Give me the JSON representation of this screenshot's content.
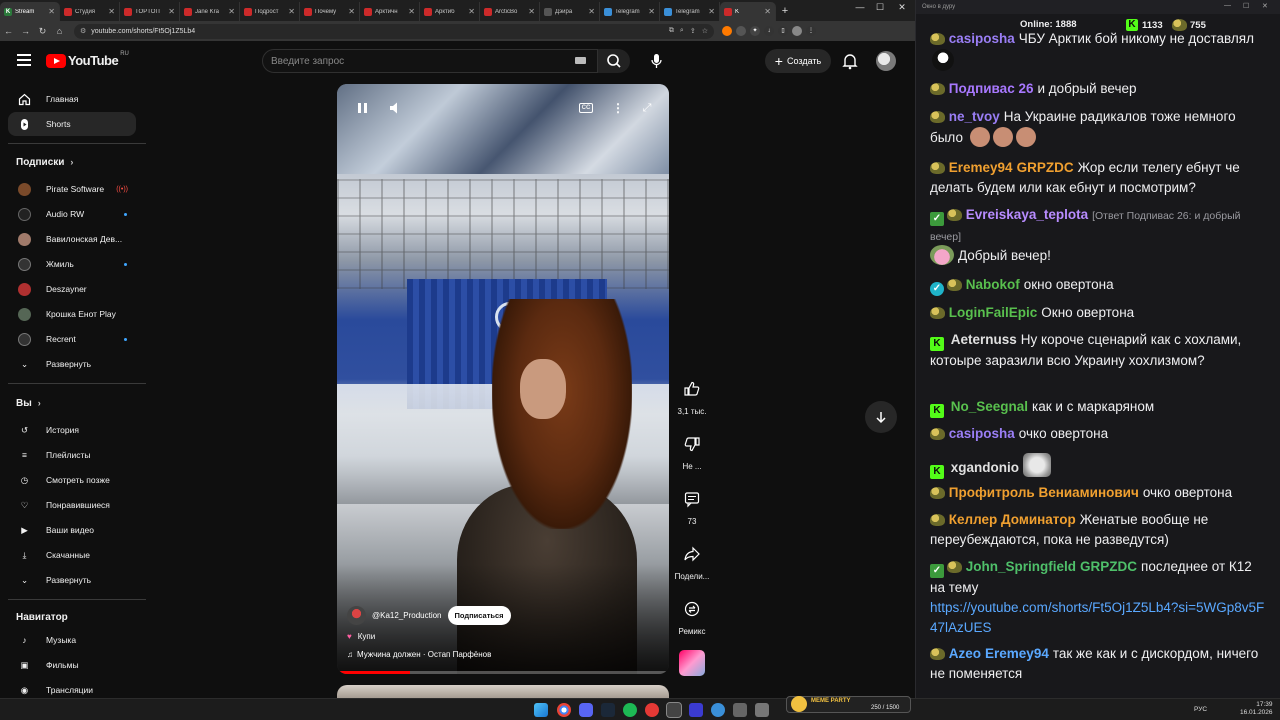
{
  "browser": {
    "tabs": [
      {
        "title": "Stream",
        "color": "#2b7a3b",
        "glyph": "K"
      },
      {
        "title": "Студия",
        "color": "#cc2a2a",
        "glyph": ""
      },
      {
        "title": "TOPTOП",
        "color": "#cc2a2a",
        "glyph": ""
      },
      {
        "title": "Jane Kra",
        "color": "#cc2a2a",
        "glyph": ""
      },
      {
        "title": "Подрост",
        "color": "#cc2a2a",
        "glyph": ""
      },
      {
        "title": "Почему",
        "color": "#cc2a2a",
        "glyph": ""
      },
      {
        "title": "Арктичн",
        "color": "#cc2a2a",
        "glyph": ""
      },
      {
        "title": "Арктиб",
        "color": "#cc2a2a",
        "glyph": ""
      },
      {
        "title": "ArcticBo",
        "color": "#cc2a2a",
        "glyph": ""
      },
      {
        "title": "Дэйра",
        "color": "#555555",
        "glyph": ""
      },
      {
        "title": "Telegram",
        "color": "#3a8fd8",
        "glyph": ""
      },
      {
        "title": "Telegram",
        "color": "#3a8fd8",
        "glyph": ""
      },
      {
        "title": "K",
        "color": "#cc2a2a",
        "glyph": ""
      }
    ],
    "new_tab": "+",
    "url": "youtube.com/shorts/Ft5Oj1Z5Lb4"
  },
  "youtube": {
    "logo_text": "YouTube",
    "region": "RU",
    "search_placeholder": "Введите запрос",
    "create_label": "Создать",
    "sidebar": {
      "main": [
        {
          "label": "Главная",
          "icon": "home-icon"
        },
        {
          "label": "Shorts",
          "icon": "shorts-icon"
        }
      ],
      "subscriptions_title": "Подписки",
      "subscriptions": [
        {
          "label": "Pirate Software",
          "color": "#7a4a2a",
          "indicator": "live"
        },
        {
          "label": "Audio RW",
          "color": "#222222",
          "indicator": "dot"
        },
        {
          "label": "Вавилонская Дев...",
          "color": "#a07a6a",
          "indicator": ""
        },
        {
          "label": "Жмиль",
          "color": "#333333",
          "indicator": "dot"
        },
        {
          "label": "Deszayner",
          "color": "#b03030",
          "indicator": ""
        },
        {
          "label": "Крошка Енот Play",
          "color": "#556655",
          "indicator": ""
        },
        {
          "label": "Recrent",
          "color": "#333333",
          "indicator": "dot"
        }
      ],
      "expand_label": "Развернуть",
      "you_title": "Вы",
      "you_items": [
        {
          "label": "История",
          "icon": "history-icon"
        },
        {
          "label": "Плейлисты",
          "icon": "playlists-icon"
        },
        {
          "label": "Смотреть позже",
          "icon": "watch-later-icon"
        },
        {
          "label": "Понравившиеся",
          "icon": "like-icon"
        },
        {
          "label": "Ваши видео",
          "icon": "your-videos-icon"
        },
        {
          "label": "Скачанные",
          "icon": "downloads-icon"
        },
        {
          "label": "Развернуть",
          "icon": "chevron-down-icon"
        }
      ],
      "navigator_title": "Навигатор",
      "navigator_items": [
        {
          "label": "Музыка",
          "icon": "music-icon"
        },
        {
          "label": "Фильмы",
          "icon": "films-icon"
        },
        {
          "label": "Трансляции",
          "icon": "live-icon"
        }
      ]
    },
    "short": {
      "channel": "@Ka12_Production",
      "subscribe_label": "Подписаться",
      "caption": "Купи",
      "music": "Мужчина должен · Остап Парфёнов",
      "progress": 0.22
    },
    "actions": {
      "likes": "3,1 тыс.",
      "dislike": "Не ...",
      "comments": "73",
      "share": "Подели...",
      "remix": "Ремикс"
    }
  },
  "chat": {
    "window_title": "Окно в дуру",
    "online_label": "Online:",
    "online_count": "1888",
    "kick_count": "1133",
    "coin_count": "755",
    "messages": [
      {
        "nick": "casiposha",
        "color": "#9a7ef5",
        "text": "ЧБУ Арктик бой никому не доставлял",
        "badges": [
          "frog"
        ]
      },
      {
        "nick": "Подпивас 26",
        "color": "#a878ff",
        "text": "и добрый вечер",
        "badges": [
          "frog"
        ]
      },
      {
        "nick": "ne_tvoy",
        "color": "#9a7ef5",
        "text": "На Украине радикалов тоже немного было",
        "badges": [
          "frog"
        ]
      },
      {
        "nick": "Eremey94",
        "color": "#f0a030",
        "text": "Жор если телегу ебнут че делать будем или как ебнут и посмотрим?",
        "badges": [
          "frog"
        ],
        "mention": "GRPZDC",
        "mention_color": "#f0a030"
      },
      {
        "nick": "Evreiskaya_teplota",
        "color": "#b88cff",
        "text": "[Ответ Подпивас 26: и добрый вечер]",
        "badges": [
          "check",
          "frog"
        ]
      },
      {
        "nick": "",
        "color": "#efeff1",
        "text": "Добрый вечер!",
        "badges": []
      },
      {
        "nick": "Nabokof",
        "color": "#59c04e",
        "text": "окно овертона",
        "badges": [
          "verified",
          "frog"
        ]
      },
      {
        "nick": "LoginFailEpic",
        "color": "#59c04e",
        "text": "Окно овертона",
        "badges": [
          "frog"
        ]
      },
      {
        "nick": "Aeternuss",
        "color": "#e0e0e0",
        "text": "Ну короче сценарий как с хохлами, котоыре заразили всю Украину хохлизмом?",
        "badges": [
          "kick"
        ]
      },
      {
        "nick": "No_Seegnal",
        "color": "#59c04e",
        "text": "как и с маркаряном",
        "badges": [
          "kick"
        ]
      },
      {
        "nick": "casiposha",
        "color": "#9a7ef5",
        "text": "очко овертона",
        "badges": [
          "frog"
        ]
      },
      {
        "nick": "xgandonio",
        "color": "#e0e0e0",
        "text": "",
        "badges": [
          "kick"
        ]
      },
      {
        "nick": "Профитроль Вениаминович",
        "color": "#f0a030",
        "text": "очко овертона",
        "badges": [
          "frog"
        ]
      },
      {
        "nick": "Келлер Доминатор",
        "color": "#f0a030",
        "text": "Женатые вообще не переубеждаются, пока не разведутся)",
        "badges": [
          "frog"
        ]
      },
      {
        "nick": "John_Springfield",
        "color": "#4fc06a",
        "text": "последнее от К12 на тему",
        "badges": [
          "check",
          "frog"
        ],
        "mention": "GRPZDC",
        "mention_color": "#4fc06a",
        "link": "https://youtube.com/shorts/Ft5Oj1Z5Lb4?si=5WGp8v5F47lAzUES"
      },
      {
        "nick": "Azeo",
        "color": "#5aa8ff",
        "text": "так же как и с дискордом, ничего не поменяется",
        "badges": [
          "frog"
        ],
        "mention": "Eremey94",
        "mention_color": "#5aa8ff"
      }
    ]
  },
  "taskbar": {
    "lang": "РУС",
    "time": "17:39",
    "date": "16.01.2026",
    "widget_title": "MEME PARTY",
    "widget_value": "250 / 1500"
  }
}
